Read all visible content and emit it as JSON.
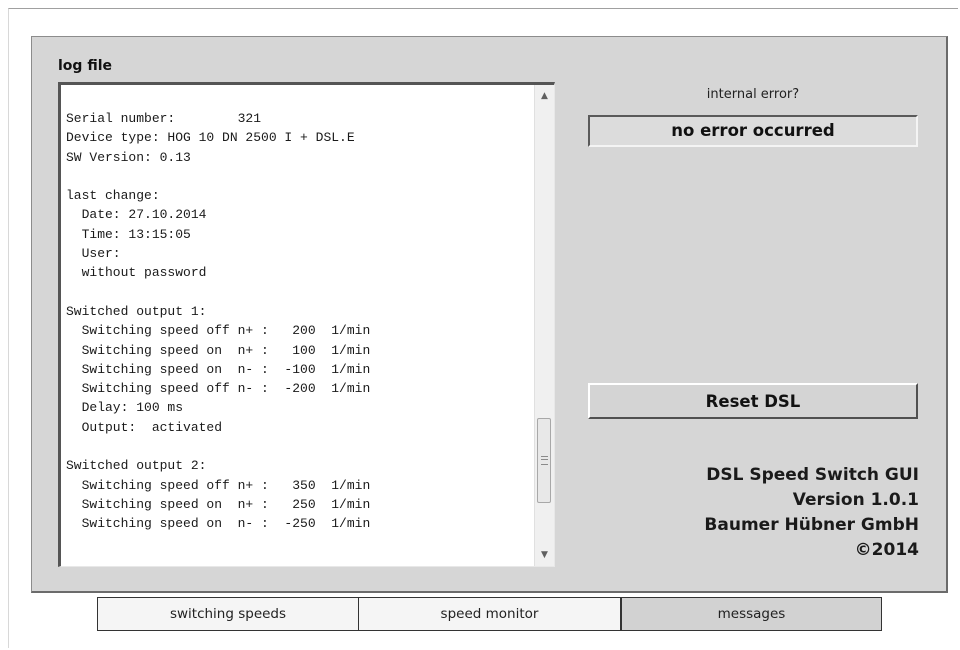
{
  "log": {
    "title": "log file",
    "content": "Serial number:        321\nDevice type: HOG 10 DN 2500 I + DSL.E\nSW Version: 0.13\n\nlast change:\n  Date: 27.10.2014\n  Time: 13:15:05\n  User:\n  without password\n\nSwitched output 1:\n  Switching speed off n+ :   200  1/min\n  Switching speed on  n+ :   100  1/min\n  Switching speed on  n- :  -100  1/min\n  Switching speed off n- :  -200  1/min\n  Delay: 100 ms\n  Output:  activated\n\nSwitched output 2:\n  Switching speed off n+ :   350  1/min\n  Switching speed on  n+ :   250  1/min\n  Switching speed on  n- :  -250  1/min"
  },
  "status": {
    "label": "internal error?",
    "value": "no error occurred"
  },
  "actions": {
    "reset_label": "Reset DSL"
  },
  "info": {
    "line1": "DSL Speed Switch GUI",
    "line2": "Version 1.0.1",
    "line3": "Baumer Hübner GmbH",
    "line4": "©2014"
  },
  "tabs": [
    {
      "label": "switching speeds"
    },
    {
      "label": "speed monitor"
    },
    {
      "label": "messages"
    }
  ],
  "active_tab": "messages",
  "icons": {
    "scroll_up": "▲",
    "scroll_down": "▼"
  }
}
